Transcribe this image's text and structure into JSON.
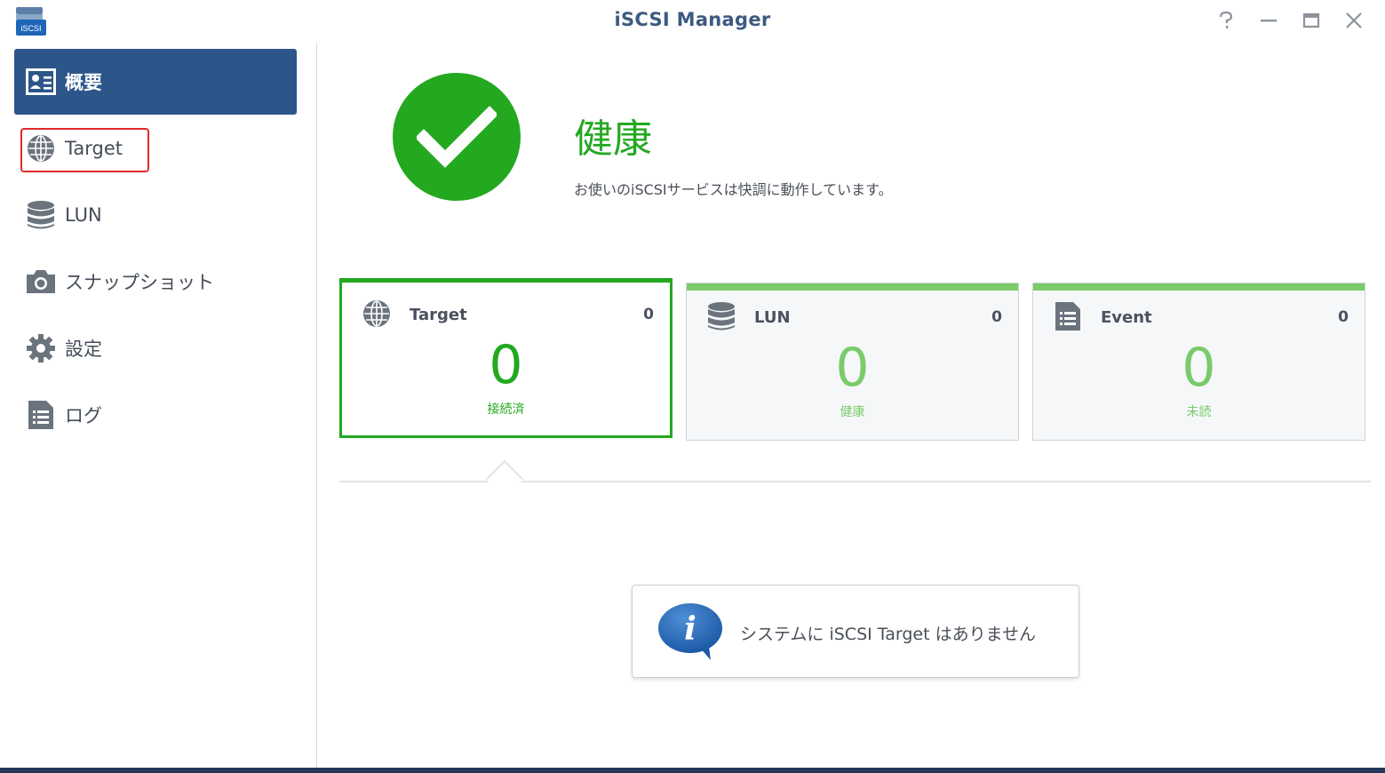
{
  "window": {
    "title": "iSCSI Manager",
    "app_icon_text": "iSCSI"
  },
  "sidebar": {
    "items": [
      {
        "label": "概要",
        "icon": "overview-card-icon"
      },
      {
        "label": "Target",
        "icon": "globe-icon"
      },
      {
        "label": "LUN",
        "icon": "database-icon"
      },
      {
        "label": "スナップショット",
        "icon": "camera-icon"
      },
      {
        "label": "設定",
        "icon": "gear-icon"
      },
      {
        "label": "ログ",
        "icon": "log-list-icon"
      }
    ],
    "active_index": 0
  },
  "status": {
    "title": "健康",
    "description": "お使いのiSCSIサービスは快調に動作しています。",
    "icon": "checkmark-icon",
    "color": "#23a820"
  },
  "cards": [
    {
      "title": "Target",
      "count": "0",
      "big": "0",
      "sub": "接続済",
      "icon": "globe-icon",
      "selected": true
    },
    {
      "title": "LUN",
      "count": "0",
      "big": "0",
      "sub": "健康",
      "icon": "database-icon",
      "selected": false
    },
    {
      "title": "Event",
      "count": "0",
      "big": "0",
      "sub": "未読",
      "icon": "log-list-icon",
      "selected": false
    }
  ],
  "info": {
    "message": "システムに iSCSI Target はありません",
    "icon": "info-bubble-icon"
  },
  "colors": {
    "accent": "#2c5689",
    "healthy": "#23a820",
    "healthy_light": "#7acb6a",
    "highlight": "#e02b2b"
  }
}
